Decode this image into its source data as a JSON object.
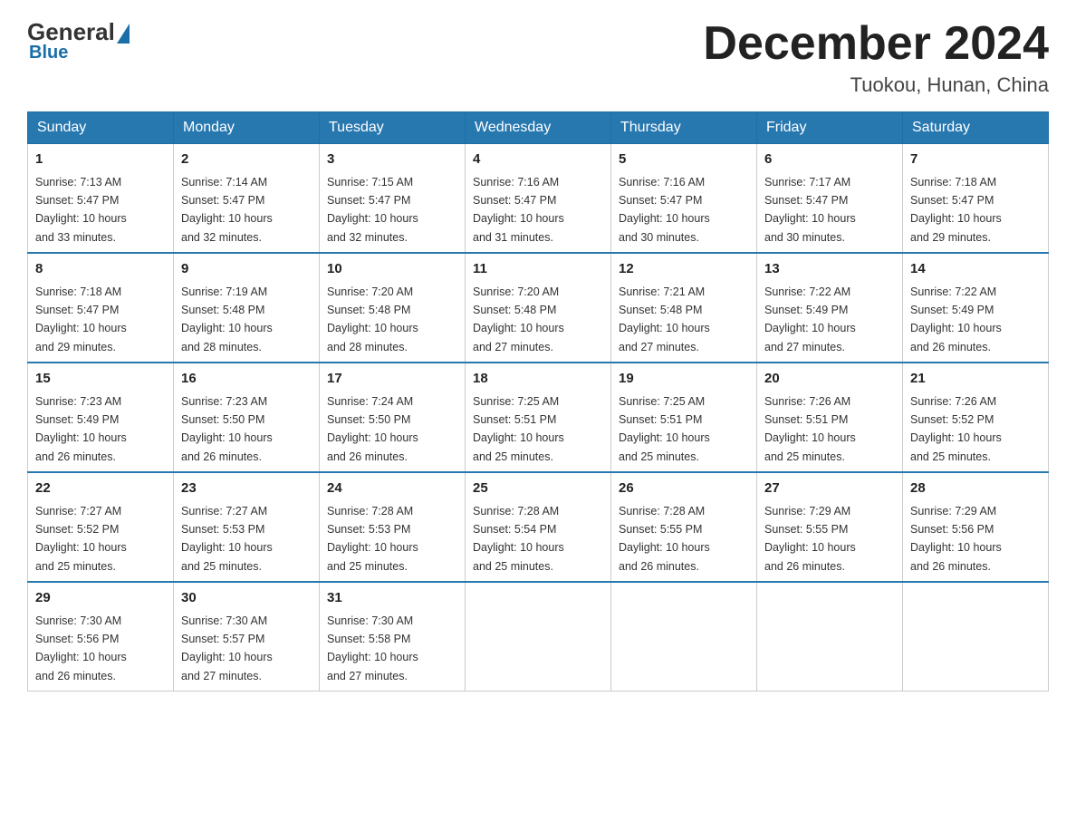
{
  "header": {
    "logo": {
      "general": "General",
      "blue": "Blue"
    },
    "title": "December 2024",
    "location": "Tuokou, Hunan, China"
  },
  "days_of_week": [
    "Sunday",
    "Monday",
    "Tuesday",
    "Wednesday",
    "Thursday",
    "Friday",
    "Saturday"
  ],
  "weeks": [
    [
      {
        "day": "1",
        "sunrise": "7:13 AM",
        "sunset": "5:47 PM",
        "daylight": "10 hours and 33 minutes."
      },
      {
        "day": "2",
        "sunrise": "7:14 AM",
        "sunset": "5:47 PM",
        "daylight": "10 hours and 32 minutes."
      },
      {
        "day": "3",
        "sunrise": "7:15 AM",
        "sunset": "5:47 PM",
        "daylight": "10 hours and 32 minutes."
      },
      {
        "day": "4",
        "sunrise": "7:16 AM",
        "sunset": "5:47 PM",
        "daylight": "10 hours and 31 minutes."
      },
      {
        "day": "5",
        "sunrise": "7:16 AM",
        "sunset": "5:47 PM",
        "daylight": "10 hours and 30 minutes."
      },
      {
        "day": "6",
        "sunrise": "7:17 AM",
        "sunset": "5:47 PM",
        "daylight": "10 hours and 30 minutes."
      },
      {
        "day": "7",
        "sunrise": "7:18 AM",
        "sunset": "5:47 PM",
        "daylight": "10 hours and 29 minutes."
      }
    ],
    [
      {
        "day": "8",
        "sunrise": "7:18 AM",
        "sunset": "5:47 PM",
        "daylight": "10 hours and 29 minutes."
      },
      {
        "day": "9",
        "sunrise": "7:19 AM",
        "sunset": "5:48 PM",
        "daylight": "10 hours and 28 minutes."
      },
      {
        "day": "10",
        "sunrise": "7:20 AM",
        "sunset": "5:48 PM",
        "daylight": "10 hours and 28 minutes."
      },
      {
        "day": "11",
        "sunrise": "7:20 AM",
        "sunset": "5:48 PM",
        "daylight": "10 hours and 27 minutes."
      },
      {
        "day": "12",
        "sunrise": "7:21 AM",
        "sunset": "5:48 PM",
        "daylight": "10 hours and 27 minutes."
      },
      {
        "day": "13",
        "sunrise": "7:22 AM",
        "sunset": "5:49 PM",
        "daylight": "10 hours and 27 minutes."
      },
      {
        "day": "14",
        "sunrise": "7:22 AM",
        "sunset": "5:49 PM",
        "daylight": "10 hours and 26 minutes."
      }
    ],
    [
      {
        "day": "15",
        "sunrise": "7:23 AM",
        "sunset": "5:49 PM",
        "daylight": "10 hours and 26 minutes."
      },
      {
        "day": "16",
        "sunrise": "7:23 AM",
        "sunset": "5:50 PM",
        "daylight": "10 hours and 26 minutes."
      },
      {
        "day": "17",
        "sunrise": "7:24 AM",
        "sunset": "5:50 PM",
        "daylight": "10 hours and 26 minutes."
      },
      {
        "day": "18",
        "sunrise": "7:25 AM",
        "sunset": "5:51 PM",
        "daylight": "10 hours and 25 minutes."
      },
      {
        "day": "19",
        "sunrise": "7:25 AM",
        "sunset": "5:51 PM",
        "daylight": "10 hours and 25 minutes."
      },
      {
        "day": "20",
        "sunrise": "7:26 AM",
        "sunset": "5:51 PM",
        "daylight": "10 hours and 25 minutes."
      },
      {
        "day": "21",
        "sunrise": "7:26 AM",
        "sunset": "5:52 PM",
        "daylight": "10 hours and 25 minutes."
      }
    ],
    [
      {
        "day": "22",
        "sunrise": "7:27 AM",
        "sunset": "5:52 PM",
        "daylight": "10 hours and 25 minutes."
      },
      {
        "day": "23",
        "sunrise": "7:27 AM",
        "sunset": "5:53 PM",
        "daylight": "10 hours and 25 minutes."
      },
      {
        "day": "24",
        "sunrise": "7:28 AM",
        "sunset": "5:53 PM",
        "daylight": "10 hours and 25 minutes."
      },
      {
        "day": "25",
        "sunrise": "7:28 AM",
        "sunset": "5:54 PM",
        "daylight": "10 hours and 25 minutes."
      },
      {
        "day": "26",
        "sunrise": "7:28 AM",
        "sunset": "5:55 PM",
        "daylight": "10 hours and 26 minutes."
      },
      {
        "day": "27",
        "sunrise": "7:29 AM",
        "sunset": "5:55 PM",
        "daylight": "10 hours and 26 minutes."
      },
      {
        "day": "28",
        "sunrise": "7:29 AM",
        "sunset": "5:56 PM",
        "daylight": "10 hours and 26 minutes."
      }
    ],
    [
      {
        "day": "29",
        "sunrise": "7:30 AM",
        "sunset": "5:56 PM",
        "daylight": "10 hours and 26 minutes."
      },
      {
        "day": "30",
        "sunrise": "7:30 AM",
        "sunset": "5:57 PM",
        "daylight": "10 hours and 27 minutes."
      },
      {
        "day": "31",
        "sunrise": "7:30 AM",
        "sunset": "5:58 PM",
        "daylight": "10 hours and 27 minutes."
      },
      null,
      null,
      null,
      null
    ]
  ],
  "labels": {
    "sunrise": "Sunrise:",
    "sunset": "Sunset:",
    "daylight": "Daylight:"
  }
}
